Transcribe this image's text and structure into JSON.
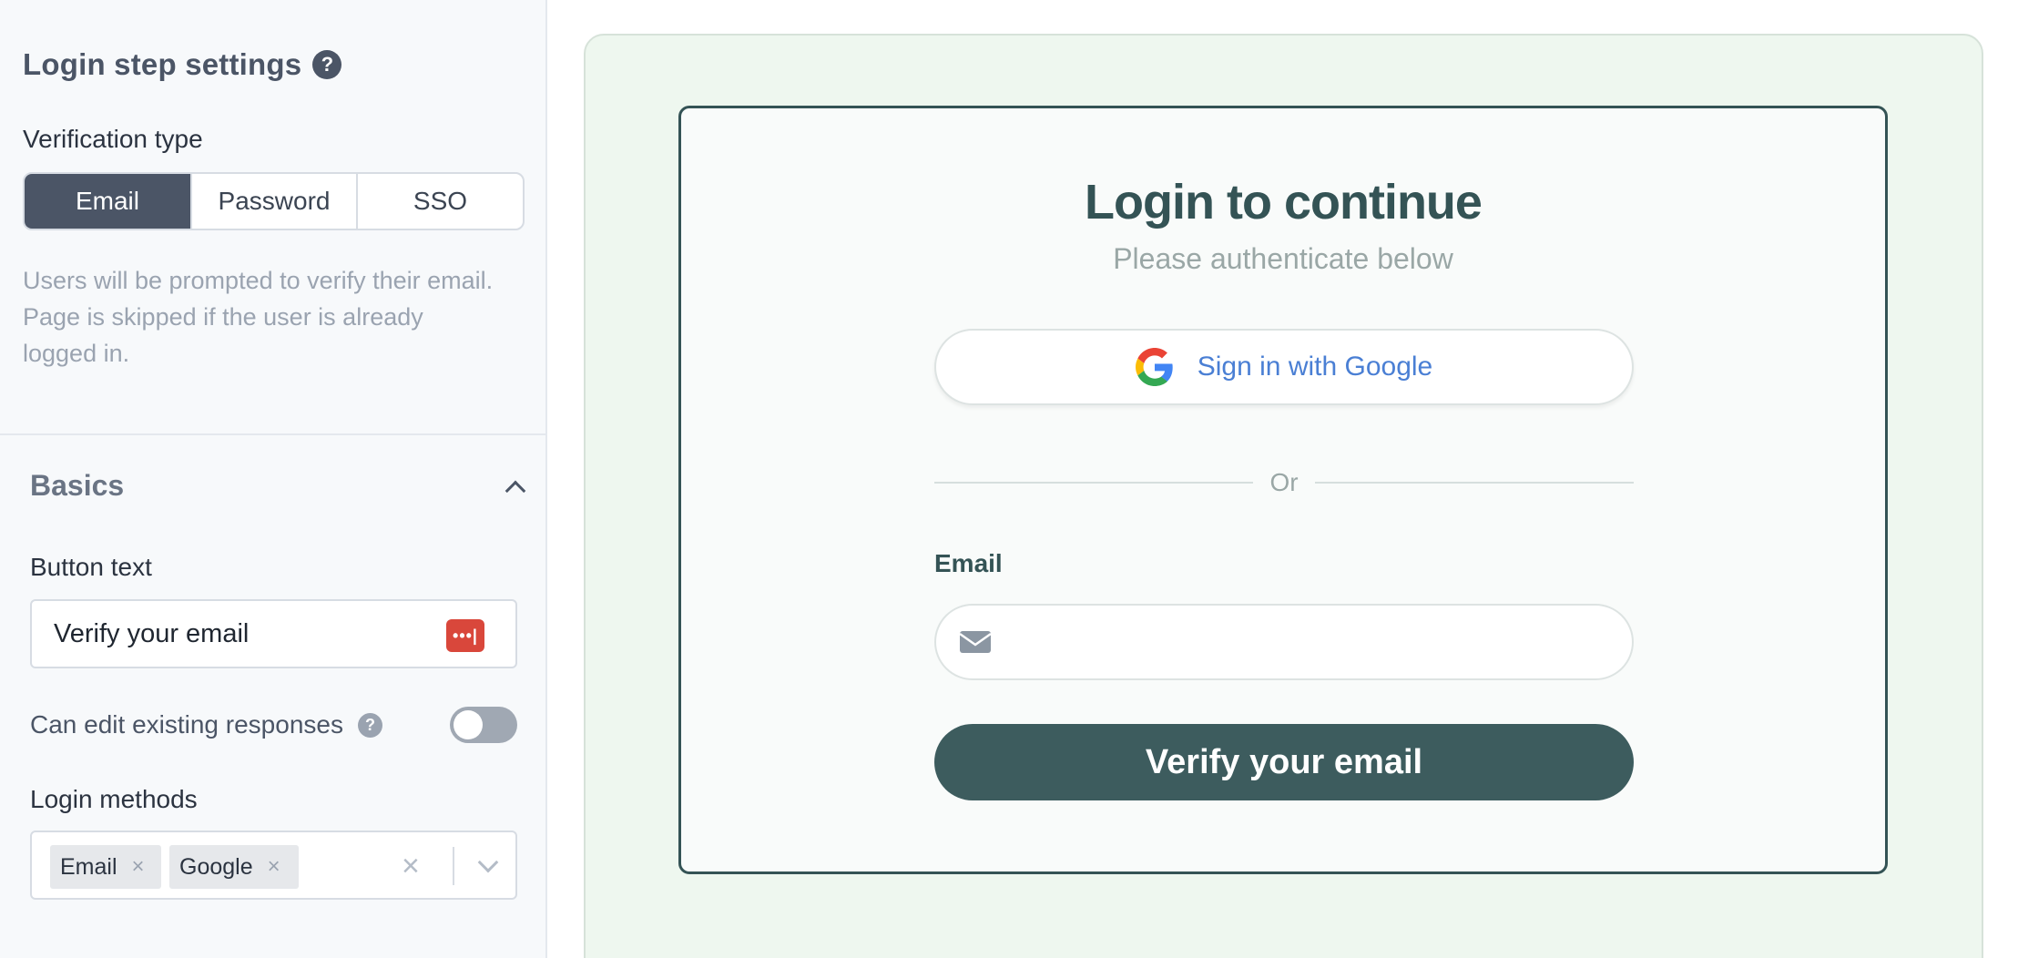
{
  "sidebar": {
    "login_step": {
      "title": "Login step settings",
      "help_glyph": "?",
      "verification_type_label": "Verification type",
      "verification_options": [
        "Email",
        "Password",
        "SSO"
      ],
      "selected_option": "Email",
      "description": "Users will be prompted to verify their email. Page is skipped if the user is already logged in."
    },
    "basics": {
      "title": "Basics",
      "expanded": true,
      "button_text_label": "Button text",
      "button_text_value": "Verify your email",
      "can_edit_label": "Can edit existing responses",
      "can_edit_help_glyph": "?",
      "can_edit_enabled": false,
      "login_methods_label": "Login methods",
      "login_methods": [
        "Email",
        "Google"
      ],
      "chip_remove_glyph": "×",
      "clear_glyph": "×"
    }
  },
  "preview": {
    "title": "Login to continue",
    "subtitle": "Please authenticate below",
    "google_button_label": "Sign in with Google",
    "divider_text": "Or",
    "email_label": "Email",
    "email_value": "",
    "verify_button_label": "Verify your email"
  },
  "colors": {
    "sidebar_bg": "#f7f9fb",
    "segment_active": "#4b5566",
    "preview_bg": "#eef7ef",
    "card_border": "#345355",
    "verify_button": "#3d5c5e",
    "google_text": "#4a7fd4",
    "password_manager_icon": "#d9473b"
  },
  "icons": [
    "help-icon",
    "chevron-up-icon",
    "password-manager-icon",
    "chip-close-icon",
    "clear-icon",
    "chevron-down-icon",
    "google-logo-icon",
    "mail-icon"
  ]
}
